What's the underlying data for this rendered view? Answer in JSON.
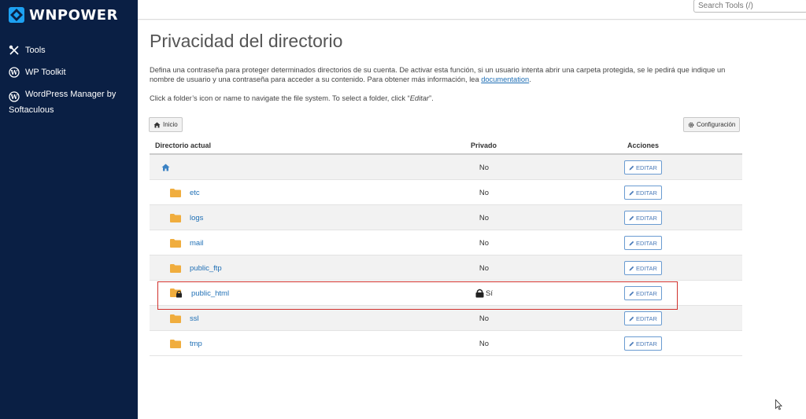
{
  "brand": {
    "name": "WNPOWER"
  },
  "sidebar": {
    "items": [
      {
        "label": "Tools",
        "icon": "tools-icon"
      },
      {
        "label": "WP Toolkit",
        "icon": "wordpress-icon"
      },
      {
        "label": "WordPress Manager by Softaculous",
        "icon": "wordpress-icon"
      }
    ]
  },
  "search": {
    "placeholder": "Search Tools (/)"
  },
  "page": {
    "title": "Privacidad del directorio",
    "description": "Defina una contraseña para proteger determinados directorios de su cuenta. De activar esta función, si un usuario intenta abrir una carpeta protegida, se le pedirá que indique un nombre de usuario y una contraseña para acceder a su contenido. Para obtener más información, lea",
    "doc_link": "documentation",
    "hint_prefix": "Click a folder’s icon or name to navigate the file system. To select a folder, click “",
    "hint_em": "Editar",
    "hint_suffix": "”."
  },
  "toolbar": {
    "home_label": "Inicio",
    "config_label": "Configuración"
  },
  "table": {
    "headers": {
      "dir": "Directorio actual",
      "private": "Privado",
      "actions": "Acciones"
    },
    "edit_label": "EDITAR",
    "rows": [
      {
        "name": "",
        "private": "No",
        "locked": false,
        "home": true
      },
      {
        "name": "etc",
        "private": "No",
        "locked": false
      },
      {
        "name": "logs",
        "private": "No",
        "locked": false
      },
      {
        "name": "mail",
        "private": "No",
        "locked": false
      },
      {
        "name": "public_ftp",
        "private": "No",
        "locked": false
      },
      {
        "name": "public_html",
        "private": "Sí",
        "locked": true
      },
      {
        "name": "ssl",
        "private": "No",
        "locked": false
      },
      {
        "name": "tmp",
        "private": "No",
        "locked": false
      }
    ]
  },
  "colors": {
    "sidebar_bg": "#0a1f44",
    "link": "#1f6fb5",
    "folder": "#f0ad3e",
    "highlight": "#d0312d"
  }
}
